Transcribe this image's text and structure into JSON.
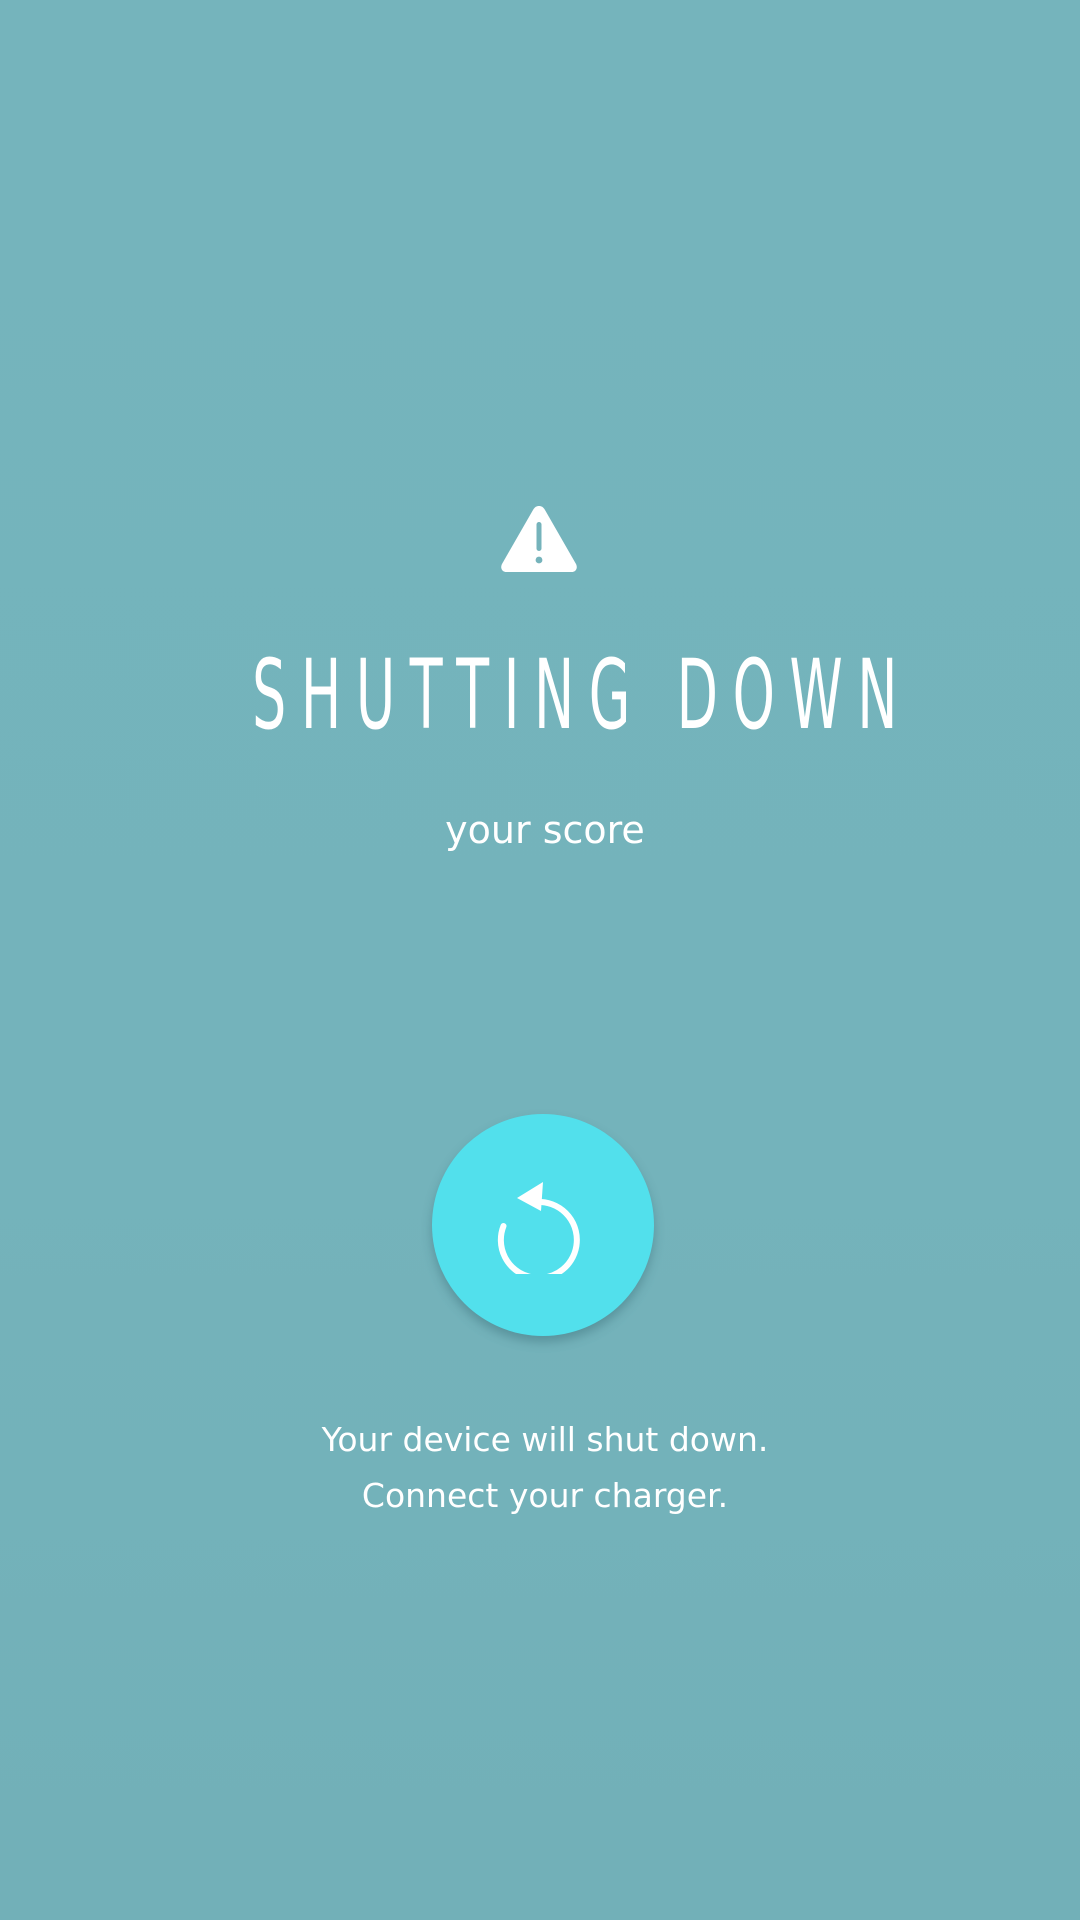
{
  "screen": {
    "background_color": "#75b3bb",
    "title": "SHUTTING DOWN",
    "subtitle": "your score",
    "warning_icon": "warning-triangle-icon",
    "restart_button": {
      "icon": "restart-icon",
      "color": "#52e0ec"
    },
    "message": {
      "line1": "Your device will shut down.",
      "line2": "Connect your charger."
    }
  }
}
